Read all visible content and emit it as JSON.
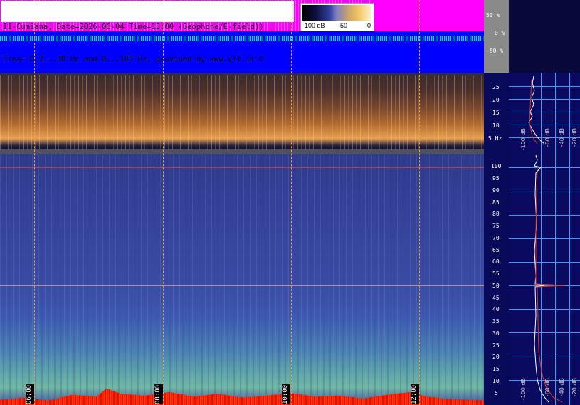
{
  "header": {
    "line1": "I1-Cumiana, Date=2026-06-04 Time=13:00 (Geophone/E-field))",
    "line2": "Freq= 0.2...30 Hz and 0...105 Hz, provided by www.vlf.it ©"
  },
  "legend": {
    "min_label": "-100 dB",
    "mid_label": "-50",
    "max_label": "0"
  },
  "waveform_axis": [
    "50 %",
    "0 %",
    "-50 %"
  ],
  "low_spectrogram_axis": [
    "25",
    "20",
    "15",
    "10",
    "5 Hz"
  ],
  "high_spectrogram_axis": [
    "100",
    "95",
    "90",
    "85",
    "80",
    "75",
    "70",
    "65",
    "60",
    "55",
    "50",
    "45",
    "40",
    "35",
    "30",
    "25",
    "20",
    "15",
    "10",
    "5"
  ],
  "time_labels": [
    "06:00",
    "08:00",
    "10:00",
    "12:00"
  ],
  "side_labels_low": [
    "-100 dB",
    "-60 dB",
    "-40 dB",
    "-20 dB"
  ],
  "side_labels_high": [
    "-100 dB",
    "-60 dB",
    "-40 dB",
    "-20 dB"
  ],
  "colors": {
    "waveform_bg": "#0000ff",
    "waveform_fill": "#ff00ff",
    "trace": "#00e0ff",
    "mains_line": "#e03020",
    "grid": "#3aa0ff"
  }
}
